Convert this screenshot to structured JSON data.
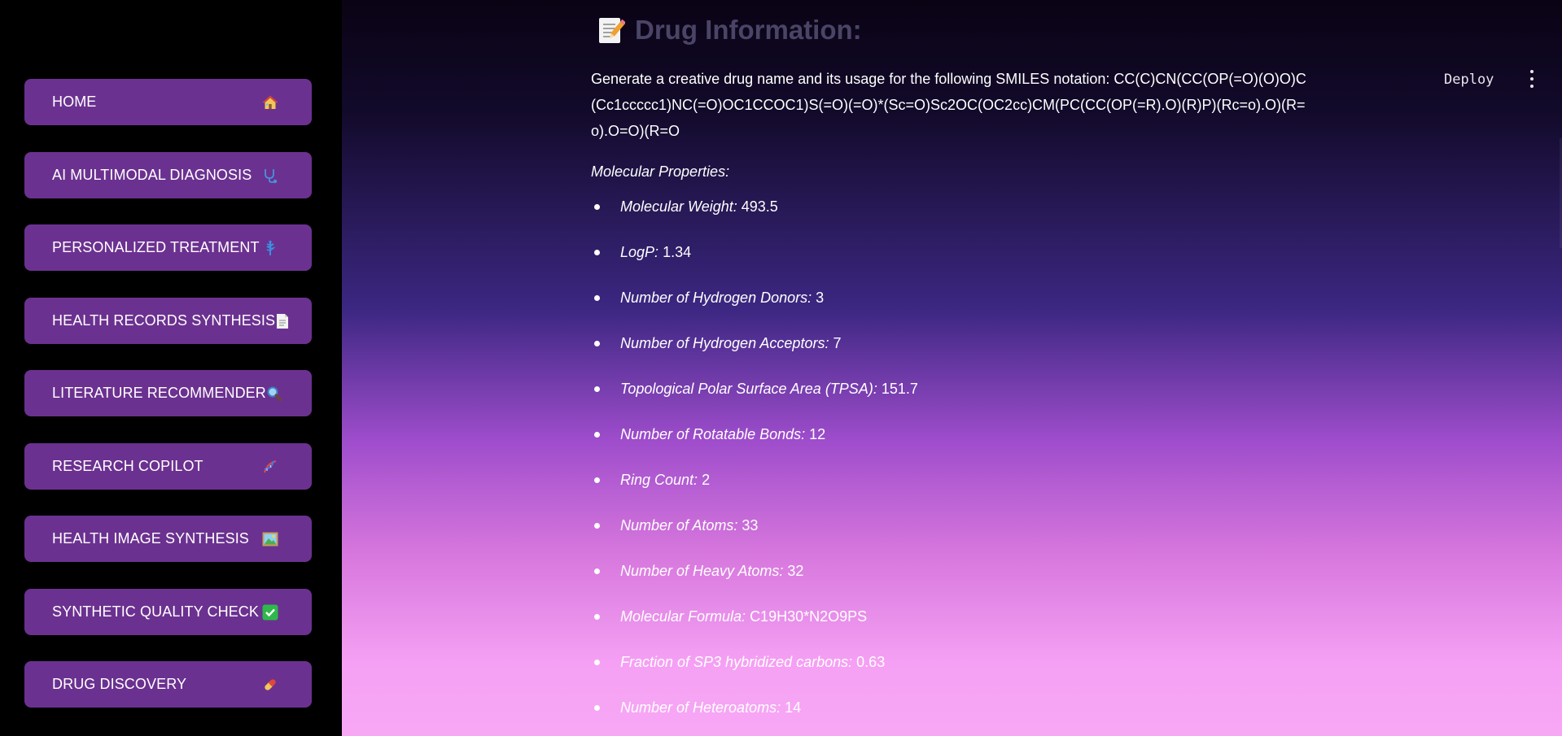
{
  "sidebar": {
    "items": [
      {
        "label": "HOME",
        "icon": "house-icon"
      },
      {
        "label": "AI MULTIMODAL DIAGNOSIS",
        "icon": "stethoscope-icon"
      },
      {
        "label": "PERSONALIZED TREATMENT",
        "icon": "medical-staff-icon"
      },
      {
        "label": "HEALTH RECORDS SYNTHESIS",
        "icon": "document-icon"
      },
      {
        "label": "LITERATURE RECOMMENDER",
        "icon": "magnifying-glass-icon"
      },
      {
        "label": "RESEARCH COPILOT",
        "icon": "dna-icon"
      },
      {
        "label": "HEALTH IMAGE SYNTHESIS",
        "icon": "framed-picture-icon"
      },
      {
        "label": "SYNTHETIC QUALITY CHECK",
        "icon": "check-mark-icon"
      },
      {
        "label": "DRUG DISCOVERY",
        "icon": "pill-icon"
      }
    ]
  },
  "toolbar": {
    "deploy_label": "Deploy",
    "menu_icon": "kebab-menu-icon"
  },
  "header": {
    "title": "Drug Information:",
    "icon": "memo-icon"
  },
  "content": {
    "prompt": "Generate a creative drug name and its usage for the following SMILES notation: CC(C)CN(CC(OP(=O)(O)O)C(Cc1ccccc1)NC(=O)OC1CCOC1)S(=O)(=O)*(Sc=O)Sc2OC(OC2cc)CM(PC(CC(OP(=R).O)(R)P)(Rc=o).O)(R=o).O=O)(R=O",
    "properties_heading": "Molecular Properties:",
    "properties": [
      {
        "label": "Molecular Weight:",
        "value": "493.5"
      },
      {
        "label": "LogP:",
        "value": "1.34"
      },
      {
        "label": "Number of Hydrogen Donors:",
        "value": "3"
      },
      {
        "label": "Number of Hydrogen Acceptors:",
        "value": "7"
      },
      {
        "label": "Topological Polar Surface Area (TPSA):",
        "value": "151.7"
      },
      {
        "label": "Number of Rotatable Bonds:",
        "value": "12"
      },
      {
        "label": "Ring Count:",
        "value": "2"
      },
      {
        "label": "Number of Atoms:",
        "value": "33"
      },
      {
        "label": "Number of Heavy Atoms:",
        "value": "32"
      },
      {
        "label": "Molecular Formula:",
        "value": "C19H30*N2O9PS"
      },
      {
        "label": "Fraction of SP3 hybridized carbons:",
        "value": "0.63"
      },
      {
        "label": "Number of Heteroatoms:",
        "value": "14"
      }
    ]
  },
  "colors": {
    "sidebar_bg": "#000000",
    "nav_button_bg": "#6b3190",
    "title_color": "#4a4566",
    "gradient_top": "#0a0314",
    "gradient_mid": "#3c2782",
    "gradient_bottom": "#f7a8f5"
  }
}
